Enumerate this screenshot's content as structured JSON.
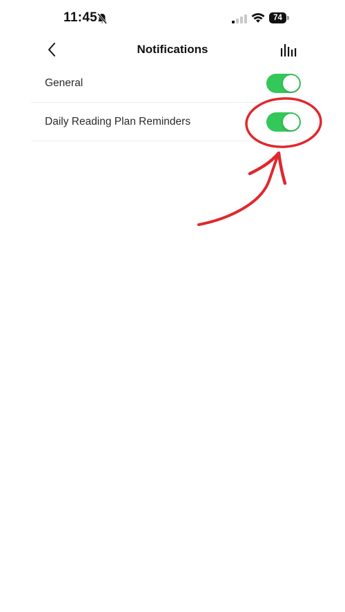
{
  "status_bar": {
    "time": "11:45",
    "battery_level": "74",
    "icons": [
      "bell-slash-icon",
      "signal-icon",
      "wifi-icon",
      "battery-icon"
    ]
  },
  "nav": {
    "title": "Notifications",
    "back_icon": "chevron-left-icon",
    "right_icon": "bar-chart-icon"
  },
  "settings": [
    {
      "label": "General",
      "enabled": true
    },
    {
      "label": "Daily Reading Plan Reminders",
      "enabled": true
    }
  ],
  "colors": {
    "toggle_on": "#34c759",
    "annotation_red": "#e0282d"
  }
}
